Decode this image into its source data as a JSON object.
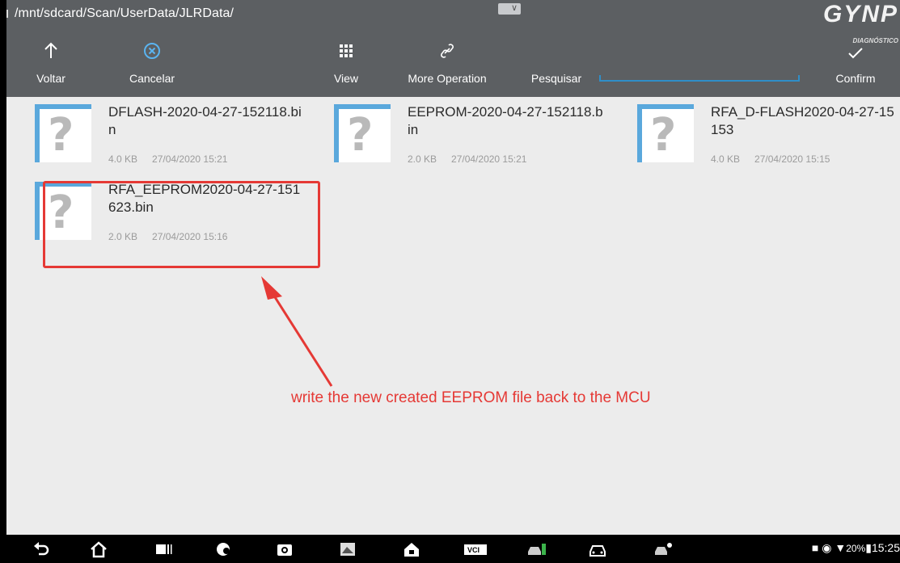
{
  "header": {
    "path": "/mnt/sdcard/Scan/UserData/JLRData/",
    "brand": "GYNP",
    "brand_sub": "DIAGNÓSTICO"
  },
  "toolbar": {
    "back_label": "Voltar",
    "cancel_label": "Cancelar",
    "view_label": "View",
    "more_label": "More Operation",
    "search_label": "Pesquisar",
    "search_value": "",
    "confirm_label": "Confirm"
  },
  "files": [
    {
      "name": "DFLASH-2020-04-27-152118.bin",
      "size": "4.0 KB",
      "date": "27/04/2020 15:21"
    },
    {
      "name": "EEPROM-2020-04-27-152118.bin",
      "size": "2.0 KB",
      "date": "27/04/2020 15:21"
    },
    {
      "name": "RFA_D-FLASH2020-04-27-15153",
      "size": "4.0 KB",
      "date": "27/04/2020 15:15"
    },
    {
      "name": "RFA_EEPROM2020-04-27-151623.bin",
      "size": "2.0 KB",
      "date": "27/04/2020 15:16"
    }
  ],
  "annotation": "write the new created EEPROM file back to the MCU",
  "statusbar": {
    "battery": "20%",
    "time": "15:25"
  },
  "icons": {
    "unknown_file": "?"
  },
  "colors": {
    "toolbar_bg": "#5c5f62",
    "content_bg": "#ececec",
    "accent_blue": "#2f8ec8",
    "annotation_red": "#e53935"
  }
}
